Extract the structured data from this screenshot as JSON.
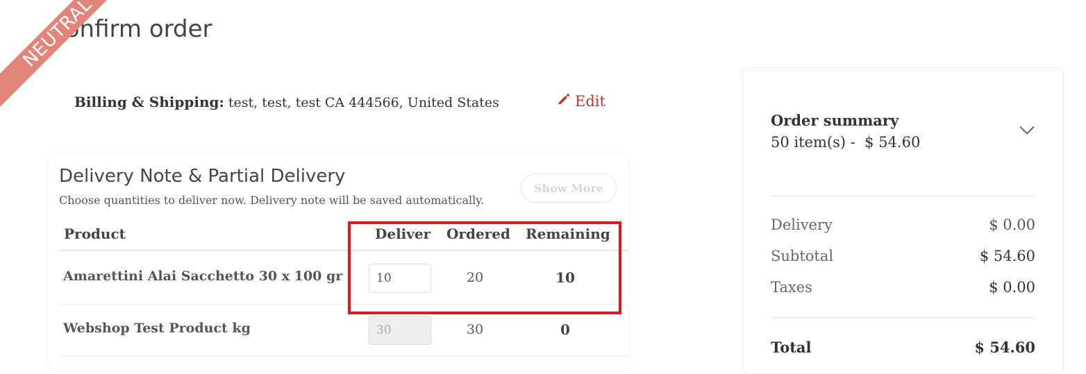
{
  "ribbon": {
    "text": "NEUTRAL"
  },
  "page": {
    "title": "Confirm order"
  },
  "billing": {
    "label": "Billing & Shipping:",
    "address": "test, test, test CA 444566, United States",
    "edit_label": "Edit"
  },
  "delivery": {
    "title": "Delivery Note & Partial Delivery",
    "subtitle": "Choose quantities to deliver now. Delivery note will be saved automatically.",
    "show_more": "Show More",
    "columns": {
      "product": "Product",
      "deliver": "Deliver",
      "ordered": "Ordered",
      "remaining": "Remaining"
    },
    "rows": [
      {
        "product": "Amarettini Alai Sacchetto 30 x 100 gr",
        "deliver": "10",
        "ordered": "20",
        "remaining": "10",
        "deliver_editable": true
      },
      {
        "product": "Webshop Test Product kg",
        "deliver": "30",
        "ordered": "30",
        "remaining": "0",
        "deliver_editable": false
      }
    ]
  },
  "summary": {
    "title": "Order summary",
    "items_line": "50 item(s) -  $ 54.60",
    "delivery_label": "Delivery",
    "delivery_value": "$ 0.00",
    "subtotal_label": "Subtotal",
    "subtotal_value": "$ 54.60",
    "taxes_label": "Taxes",
    "taxes_value": "$ 0.00",
    "total_label": "Total",
    "total_value": "$ 54.60"
  },
  "colors": {
    "accent": "#b8372a",
    "ribbon": "#e1857a",
    "highlight": "#e8141c"
  },
  "icons": {
    "edit": "pencil-icon",
    "summary_toggle": "chevron-down-icon"
  }
}
